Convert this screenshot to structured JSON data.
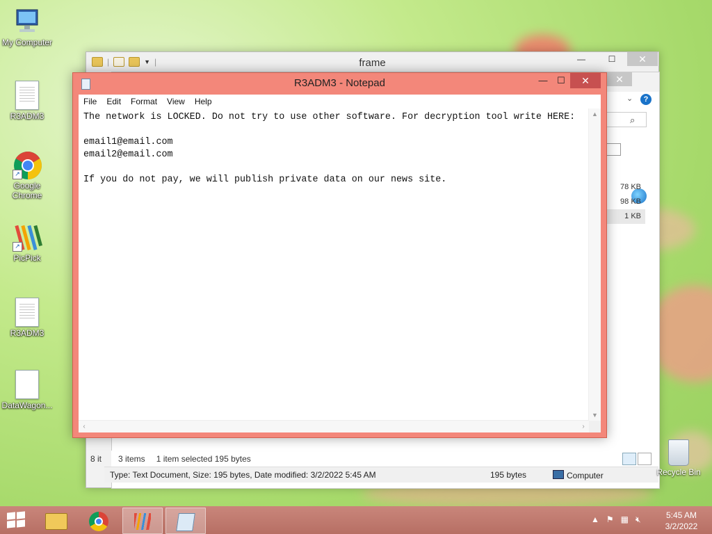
{
  "desktop": {
    "icons": [
      {
        "label": "My Computer"
      },
      {
        "label": "R3ADM3"
      },
      {
        "label": "Google Chrome"
      },
      {
        "label": "PicPick"
      },
      {
        "label": "R3ADM3"
      },
      {
        "label": "DataWagon..."
      }
    ],
    "recycle_bin": "Recycle Bin"
  },
  "explorer": {
    "title": "frame",
    "sizes": [
      "78 KB",
      "98 KB",
      "1 KB"
    ],
    "left_stub": "8 it",
    "items_count": "3 items",
    "selected": "1 item selected  195 bytes",
    "details": "Type: Text Document, Size: 195 bytes, Date modified: 3/2/2022 5:45 AM",
    "details_size": "195 bytes",
    "details_location": "Computer"
  },
  "notepad": {
    "title": "R3ADM3 - Notepad",
    "menu": [
      "File",
      "Edit",
      "Format",
      "View",
      "Help"
    ],
    "content": "The network is LOCKED. Do not try to use other software. For decryption tool write HERE:\n\nemail1@email.com\nemail2@email.com\n\nIf you do not pay, we will publish private data on our news site."
  },
  "taskbar": {
    "time": "5:45 AM",
    "date": "3/2/2022"
  },
  "colors": {
    "notepad_frame": "#f3877a",
    "close_button": "#c75050",
    "taskbar": "#b76f64"
  }
}
